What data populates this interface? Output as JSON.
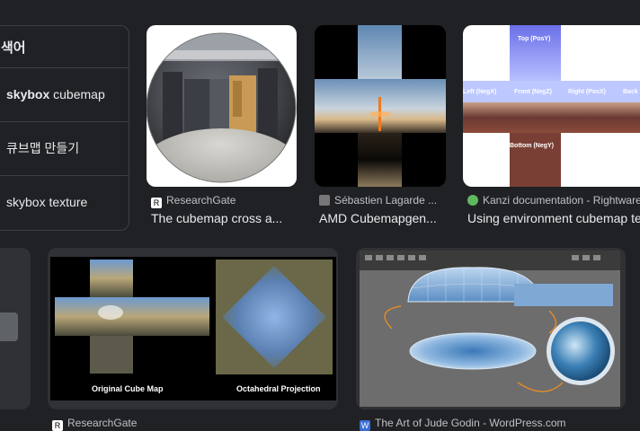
{
  "related": {
    "heading": "색어",
    "items": [
      {
        "bold": "skybox",
        "rest": " cubemap"
      },
      {
        "bold": "",
        "rest": "큐브맵 만들기"
      },
      {
        "bold": "",
        "rest": "skybox texture"
      }
    ]
  },
  "results_row1": [
    {
      "source": "ResearchGate",
      "title": "The cubemap cross a..."
    },
    {
      "source": "Sébastien Lagarde ...",
      "title": "AMD Cubemapgen..."
    },
    {
      "source": "Kanzi documentation - Rightware",
      "title": "Using environment cubemap textu"
    }
  ],
  "kanzi_labels": {
    "top": "Top (PosY)",
    "left": "Left (NegX)",
    "front": "Front (NegZ)",
    "right": "Right (PosX)",
    "back": "Back",
    "bottom": "Bottom (NegY)"
  },
  "results_row2": [
    {
      "source": "ResearchGate",
      "caption_left": "Original Cube Map",
      "caption_right": "Octahedral Projection"
    },
    {
      "source": "The Art of Jude Godin - WordPress.com"
    }
  ],
  "colors": {
    "background": "#202124",
    "card": "#303134",
    "border": "#3c4043",
    "text": "#e8eaed",
    "muted": "#bdc1c6"
  }
}
